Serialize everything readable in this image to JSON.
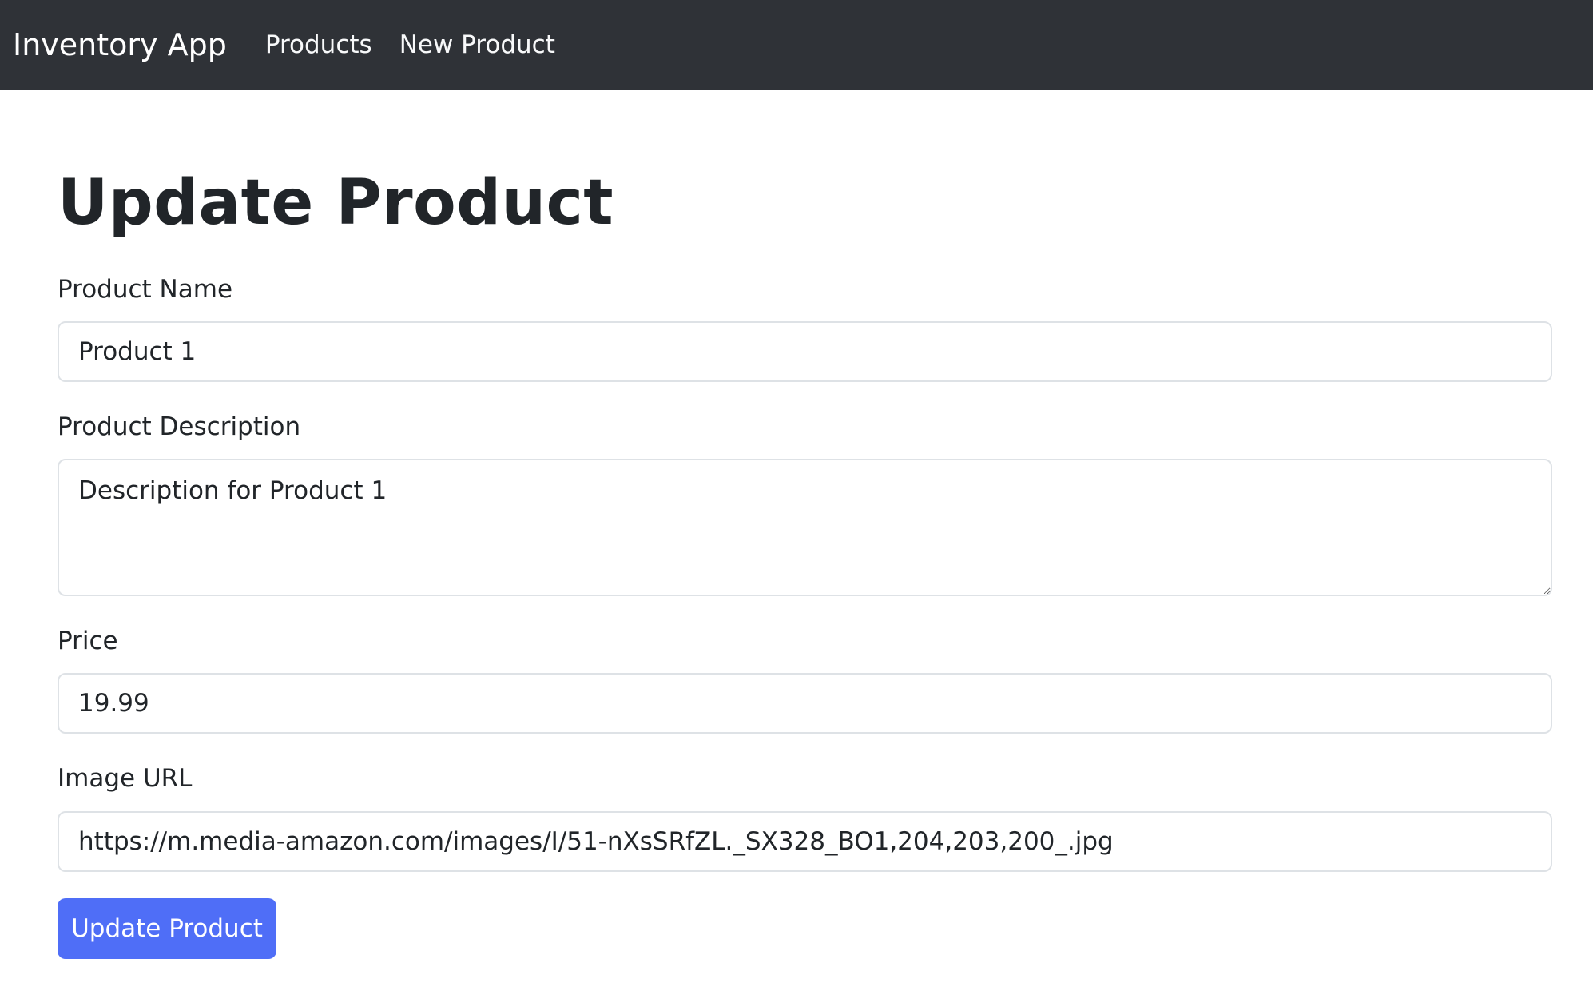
{
  "navbar": {
    "brand": "Inventory App",
    "links": [
      "Products",
      "New Product"
    ]
  },
  "page": {
    "title": "Update Product"
  },
  "form": {
    "name_label": "Product Name",
    "name_value": "Product 1",
    "description_label": "Product Description",
    "description_value": "Description for Product 1",
    "price_label": "Price",
    "price_value": "19.99",
    "image_label": "Image URL",
    "image_value": "https://m.media-amazon.com/images/I/51-nXsSRfZL._SX328_BO1,204,203,200_.jpg",
    "submit_label": "Update Product"
  },
  "colors": {
    "navbar": "#2f3237",
    "primary": "#4f6ef7",
    "input_border": "#dee2e6",
    "text": "#212529"
  }
}
